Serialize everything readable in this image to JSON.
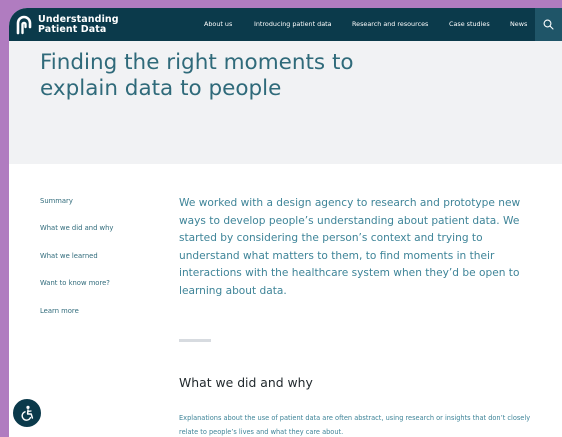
{
  "brand": {
    "name_line1": "Understanding",
    "name_line2": "Patient Data"
  },
  "nav": {
    "items": [
      {
        "label": "About us"
      },
      {
        "label": "Introducing patient data"
      },
      {
        "label": "Research and resources"
      },
      {
        "label": "Case studies"
      },
      {
        "label": "News"
      }
    ],
    "search_icon": "search-icon"
  },
  "hero": {
    "title": "Finding the right moments to explain data to people"
  },
  "sidebar": {
    "items": [
      {
        "label": "Summary"
      },
      {
        "label": "What we did and why"
      },
      {
        "label": "What we learned"
      },
      {
        "label": "Want to know more?"
      },
      {
        "label": "Learn more"
      }
    ]
  },
  "content": {
    "intro": "We worked with a design agency to research and prototype new ways to develop people’s understanding about patient data. We started by considering the person’s context and trying to understand what matters to them, to find moments in their interactions with the healthcare system when they’d be open to learning about data.",
    "section_heading": "What we did and why",
    "section_body": "Explanations about the use of patient data are often abstract, using research or insights that don’t closely relate to people’s lives and what they care about."
  },
  "accessibility": {
    "icon": "accessibility-icon"
  },
  "colors": {
    "navy": "#0b3a4b",
    "teal_text": "#2f6a7a",
    "body_teal": "#3e8498",
    "hero_bg": "#f1f2f4",
    "outer_bg": "#b07cc0"
  }
}
